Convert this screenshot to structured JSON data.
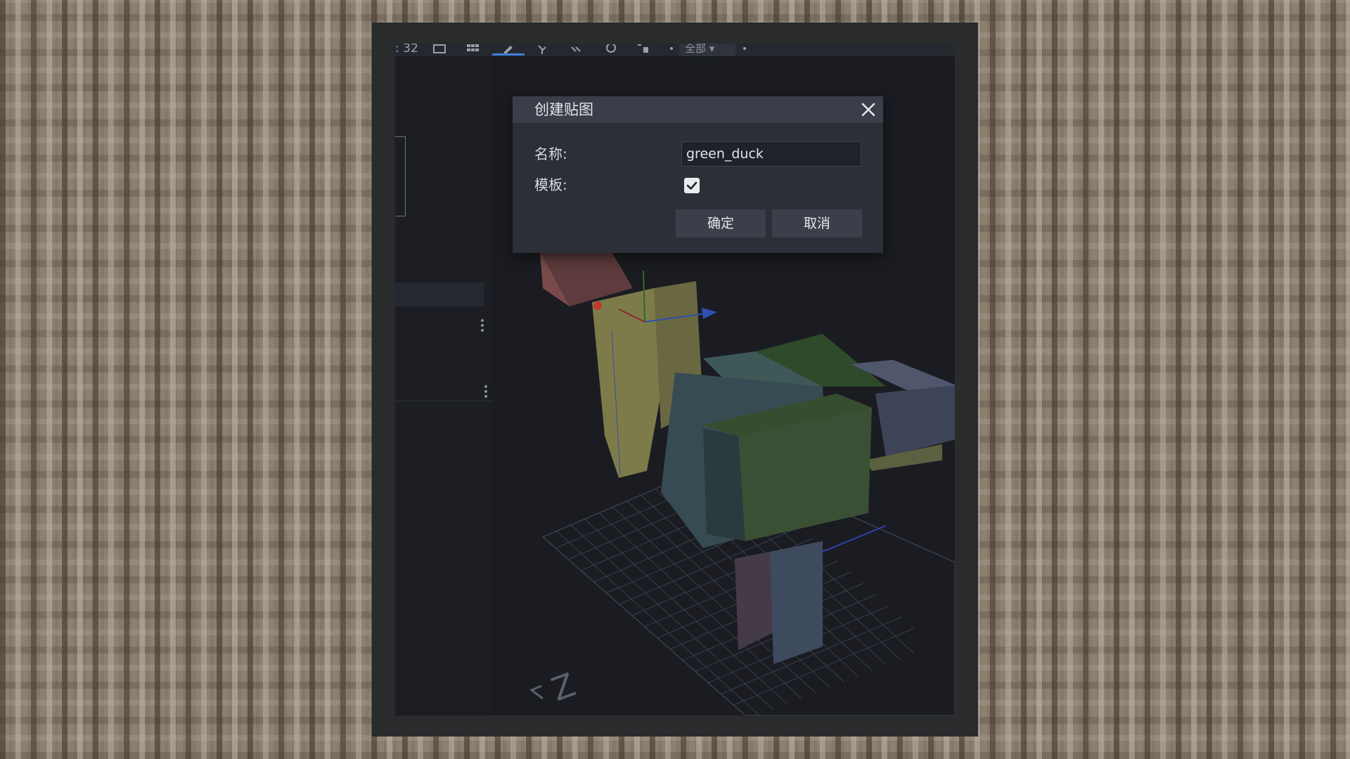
{
  "toolbar": {
    "size_value": "32",
    "view_mode": "全部"
  },
  "dialog": {
    "title": "创建贴图",
    "name_label": "名称:",
    "name_value": "green_duck",
    "template_label": "模板:",
    "template_checked": true,
    "confirm_label": "确定",
    "cancel_label": "取消"
  },
  "viewport": {
    "axis_label": "Z"
  },
  "colors": {
    "accent": "#3e7fd9",
    "dialog_bg": "#2b2f37",
    "dialog_header": "#3a3e48",
    "button_bg": "#3b3f49",
    "viewport_bg": "#1a1c22"
  }
}
